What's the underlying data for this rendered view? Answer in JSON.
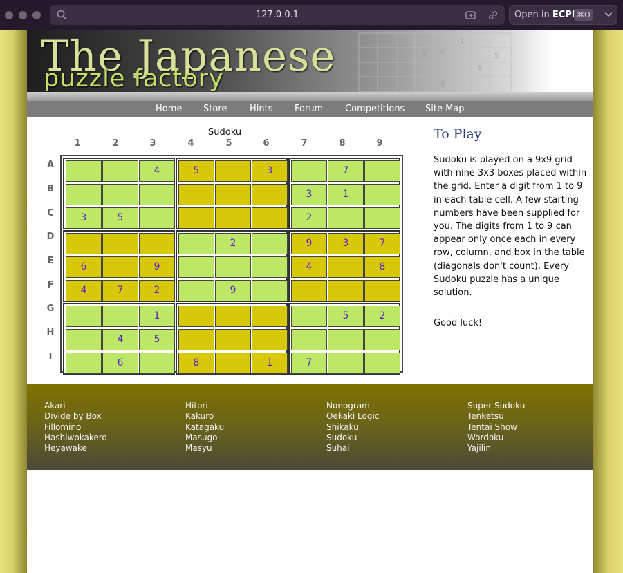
{
  "browser": {
    "url": "127.0.0.1",
    "open_in_label": "Open in",
    "open_in_app": "ECPI",
    "open_in_shortcut": "⌘O"
  },
  "header": {
    "logo_line1": "The Japanese",
    "logo_line2": "puzzle factory"
  },
  "nav": [
    "Home",
    "Store",
    "Hints",
    "Forum",
    "Competitions",
    "Site Map"
  ],
  "puzzle": {
    "title": "Sudoku",
    "columns": [
      "1",
      "2",
      "3",
      "4",
      "5",
      "6",
      "7",
      "8",
      "9"
    ],
    "rows": [
      "A",
      "B",
      "C",
      "D",
      "E",
      "F",
      "G",
      "H",
      "I"
    ],
    "colors": {
      "green": "#bde865",
      "yellow": "#d7c90a",
      "digit": "#5a1ec8"
    },
    "box_pattern": [
      [
        "green",
        "yellow",
        "green"
      ],
      [
        "yellow",
        "green",
        "yellow"
      ],
      [
        "green",
        "yellow",
        "green"
      ]
    ],
    "cells": [
      [
        "",
        "",
        "4",
        "5",
        "",
        "3",
        "",
        "7",
        ""
      ],
      [
        "",
        "",
        "",
        "",
        "",
        "",
        "3",
        "1",
        ""
      ],
      [
        "3",
        "5",
        "",
        "",
        "",
        "",
        "2",
        "",
        ""
      ],
      [
        "",
        "",
        "",
        "",
        "2",
        "",
        "9",
        "3",
        "7"
      ],
      [
        "6",
        "",
        "9",
        "",
        "",
        "",
        "4",
        "",
        "8"
      ],
      [
        "4",
        "7",
        "2",
        "",
        "9",
        "",
        "",
        "",
        ""
      ],
      [
        "",
        "",
        "1",
        "",
        "",
        "",
        "",
        "5",
        "2"
      ],
      [
        "",
        "4",
        "5",
        "",
        "",
        "",
        "",
        "",
        ""
      ],
      [
        "",
        "6",
        "",
        "8",
        "",
        "1",
        "7",
        "",
        ""
      ]
    ]
  },
  "sidebar": {
    "heading": "To Play",
    "rules": "Sudoku is played on a 9x9 grid with nine 3x3 boxes placed within the grid. Enter a digit from 1 to 9 in each table cell. A few starting numbers have been supplied for you. The digits from 1 to 9 can appear only once each in every row, column, and box in the table (diagonals don't count). Every Sudoku puzzle has a unique solution.",
    "good_luck": "Good luck!"
  },
  "footer": {
    "columns": [
      [
        "Akari",
        "Divide by Box",
        "Fillomino",
        "Hashiwokakero",
        "Heyawake"
      ],
      [
        "Hitori",
        "Kakuro",
        "Katagaku",
        "Masugo",
        "Masyu"
      ],
      [
        "Nonogram",
        "Oekaki Logic",
        "Shikaku",
        "Sudoku",
        "Suhai"
      ],
      [
        "Super Sudoku",
        "Tenketsu",
        "Tentai Show",
        "Wordoku",
        "Yajilin"
      ]
    ]
  }
}
